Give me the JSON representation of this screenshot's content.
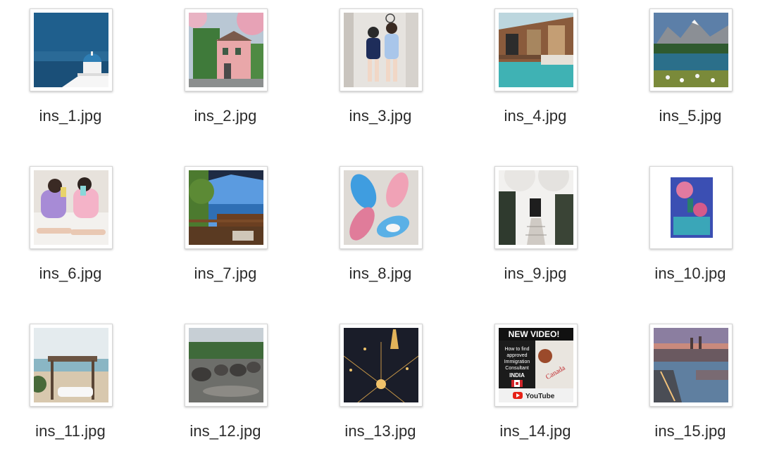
{
  "files": [
    {
      "name": "ins_1.jpg",
      "image": "santorini-dome-icon"
    },
    {
      "name": "ins_2.jpg",
      "image": "pink-house-blossom-icon"
    },
    {
      "name": "ins_3.jpg",
      "image": "two-girls-mirror-icon"
    },
    {
      "name": "ins_4.jpg",
      "image": "overwater-villa-icon"
    },
    {
      "name": "ins_5.jpg",
      "image": "mountain-lake-icon"
    },
    {
      "name": "ins_6.jpg",
      "image": "girls-on-bed-icon"
    },
    {
      "name": "ins_7.jpg",
      "image": "balcony-sea-view-icon"
    },
    {
      "name": "ins_8.jpg",
      "image": "sneakers-icon"
    },
    {
      "name": "ins_9.jpg",
      "image": "white-townhouse-icon"
    },
    {
      "name": "ins_10.jpg",
      "image": "pink-flower-painting-icon"
    },
    {
      "name": "ins_11.jpg",
      "image": "beach-cabana-icon"
    },
    {
      "name": "ins_12.jpg",
      "image": "elephants-river-icon"
    },
    {
      "name": "ins_13.jpg",
      "image": "paris-night-aerial-icon"
    },
    {
      "name": "ins_14.jpg",
      "image": "immigration-video-poster-icon"
    },
    {
      "name": "ins_15.jpg",
      "image": "prague-bridge-dusk-icon"
    }
  ],
  "poster_text": {
    "headline": "NEW VIDEO!",
    "line1": "How to find",
    "line2": "approved",
    "line3": "Immigration",
    "line4": "Consultant",
    "country": "INDIA",
    "brand": "YouTube",
    "stamp": "Canada"
  }
}
